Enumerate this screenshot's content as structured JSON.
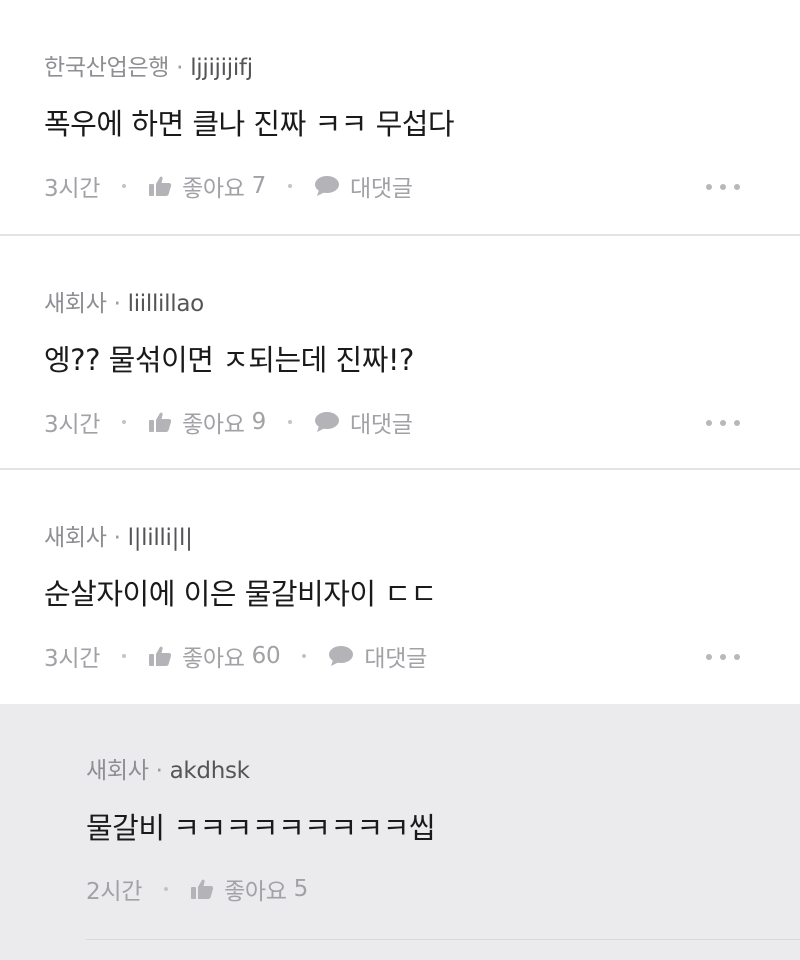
{
  "comments": [
    {
      "company": "한국산업은행",
      "user": "ljjijijifj",
      "text": "폭우에 하면 클나 진짜 ㅋㅋ 무섭다",
      "time": "3시간",
      "like_label": "좋아요",
      "likes": "7",
      "reply_label": "대댓글"
    },
    {
      "company": "새회사",
      "user": "liillillao",
      "text": "엥?? 물섞이면 ㅈ되는데 진짜!?",
      "time": "3시간",
      "like_label": "좋아요",
      "likes": "9",
      "reply_label": "대댓글"
    },
    {
      "company": "새회사",
      "user": "l|lilli|l|",
      "text": "순살자이에 이은 물갈비자이 ㄷㄷ",
      "time": "3시간",
      "like_label": "좋아요",
      "likes": "60",
      "reply_label": "대댓글"
    }
  ],
  "reply": {
    "company": "새회사",
    "user": "akdhsk",
    "text": "물갈비 ㅋㅋㅋㅋㅋㅋㅋㅋㅋ씹",
    "time": "2시간",
    "like_label": "좋아요",
    "likes": "5"
  },
  "separator": "·",
  "icons": {
    "like": "thumbs-up-icon",
    "reply": "speech-bubble-icon",
    "more": "more-dots-icon"
  },
  "colors": {
    "reply_background": "#ebebee",
    "meta_text": "#8e8e93",
    "body_text": "#1a1a1a"
  }
}
